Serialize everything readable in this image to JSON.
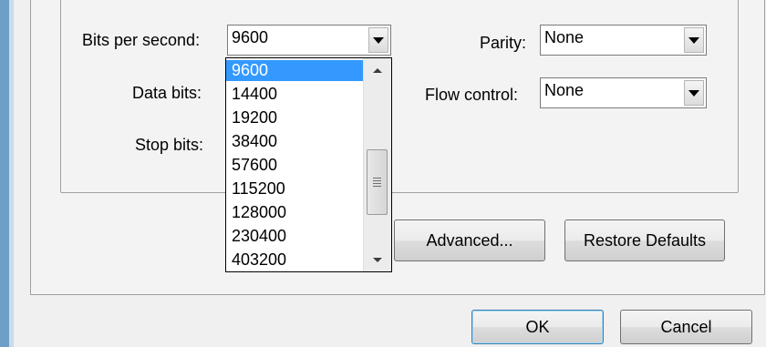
{
  "port_settings": {
    "bits_per_second": {
      "label": "Bits per second:",
      "value": "9600"
    },
    "data_bits": {
      "label": "Data bits:"
    },
    "stop_bits": {
      "label": "Stop bits:"
    },
    "parity": {
      "label": "Parity:",
      "value": "None"
    },
    "flow_control": {
      "label": "Flow control:",
      "value": "None"
    }
  },
  "baud_dropdown": {
    "options": [
      "9600",
      "14400",
      "19200",
      "38400",
      "57600",
      "115200",
      "128000",
      "230400",
      "403200"
    ],
    "selected_index": 0
  },
  "buttons": {
    "advanced": "Advanced...",
    "restore_defaults": "Restore Defaults",
    "ok": "OK",
    "cancel": "Cancel"
  },
  "colors": {
    "selection": "#3399ff",
    "window_edge": "#6f9fc6"
  }
}
